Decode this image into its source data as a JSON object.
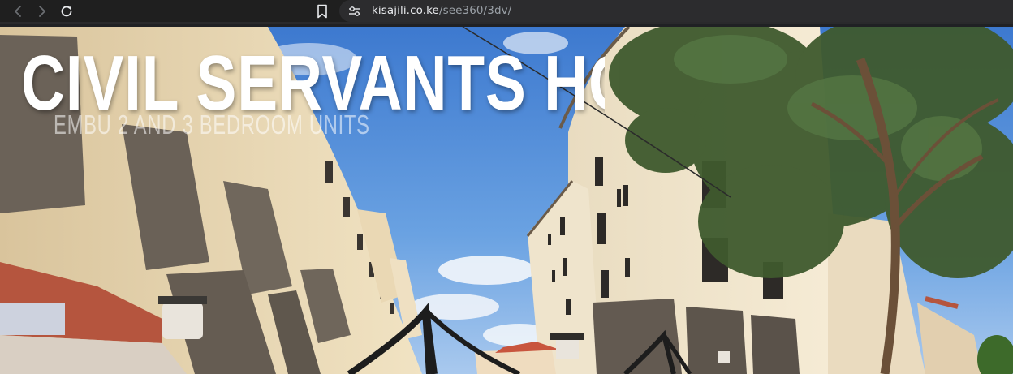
{
  "browser": {
    "url_host": "kisajili.co.ke",
    "url_path": "/see360/3dv/"
  },
  "icons": {
    "back": "chevron-left-icon",
    "forward": "chevron-right-icon",
    "reload": "reload-icon",
    "bookmark": "bookmark-icon",
    "site_info": "site-settings-icon"
  },
  "viewer": {
    "title": "CIVIL SERVANTS HO",
    "subtitle": "EMBU 2 AND 3 BEDROOM UNITS"
  },
  "colors": {
    "toolbar_bg": "#1f1f1f",
    "omnibox_bg": "#2c2c2e",
    "sky": "#5b93d9",
    "building_wall": "#e8d6b0",
    "stone_panel": "#6b6258",
    "tree": "#3f5a2e"
  }
}
